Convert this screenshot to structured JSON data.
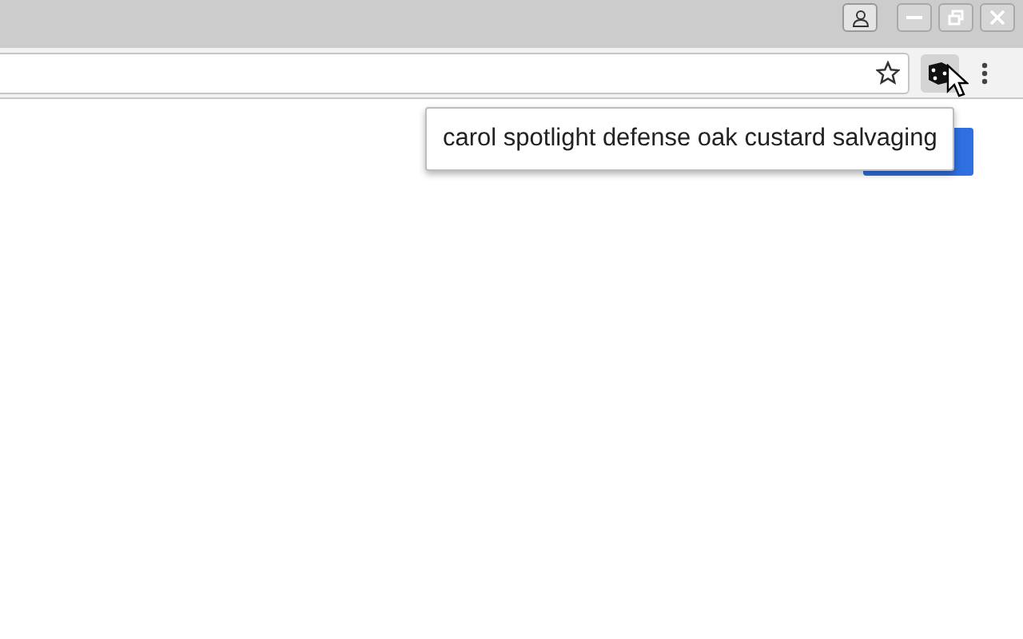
{
  "tooltip": {
    "text": "carol spotlight defense oak custard salvaging"
  },
  "extension": {
    "selected": true
  }
}
